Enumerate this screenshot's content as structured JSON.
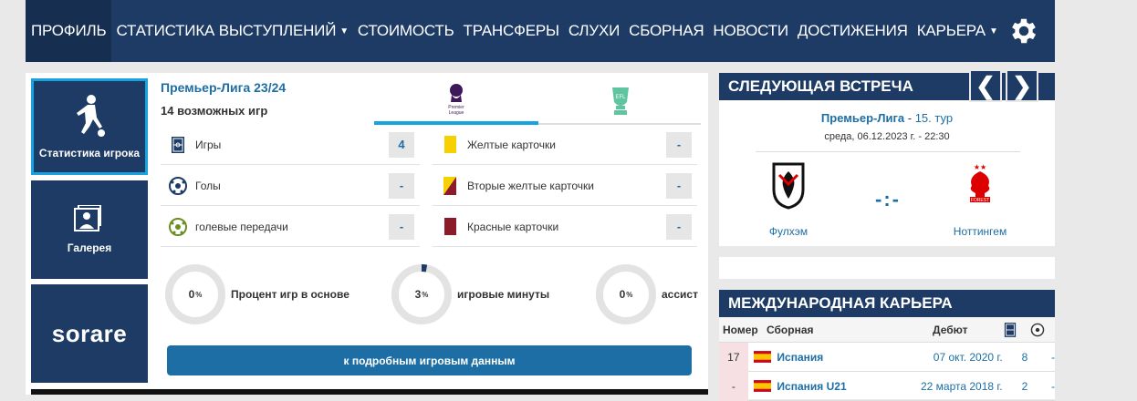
{
  "nav": {
    "items": [
      {
        "label": "ПРОФИЛЬ",
        "active": true,
        "dropdown": false
      },
      {
        "label": "СТАТИСТИКА ВЫСТУПЛЕНИЙ",
        "active": false,
        "dropdown": true
      },
      {
        "label": "СТОИМОСТЬ",
        "active": false,
        "dropdown": false
      },
      {
        "label": "ТРАНСФЕРЫ",
        "active": false,
        "dropdown": false
      },
      {
        "label": "СЛУХИ",
        "active": false,
        "dropdown": false
      },
      {
        "label": "СБОРНАЯ",
        "active": false,
        "dropdown": false
      },
      {
        "label": "НОВОСТИ",
        "active": false,
        "dropdown": false
      },
      {
        "label": "ДОСТИЖЕНИЯ",
        "active": false,
        "dropdown": false
      },
      {
        "label": "КАРЬЕРА",
        "active": false,
        "dropdown": true
      }
    ],
    "settings_icon": "gear-icon"
  },
  "tiles": {
    "player_stats": "Статистика игрока",
    "gallery": "Галерея",
    "sorare": "sorare"
  },
  "stats": {
    "league": "Премьер-Лига 23/24",
    "possible_games": "14 возможных игр",
    "competitions": [
      "Premier League",
      "EFL Cup"
    ],
    "left_rows": [
      {
        "label": "Игры",
        "value": "4",
        "icon": "pitch-icon"
      },
      {
        "label": "Голы",
        "value": "-",
        "icon": "ball-icon"
      },
      {
        "label": "голевые передачи",
        "value": "-",
        "icon": "assist-icon"
      }
    ],
    "right_rows": [
      {
        "label": "Желтые карточки",
        "value": "-",
        "icon": "yellow-card-icon"
      },
      {
        "label": "Вторые желтые карточки",
        "value": "-",
        "icon": "second-yellow-card-icon"
      },
      {
        "label": "Красные карточки",
        "value": "-",
        "icon": "red-card-icon"
      }
    ],
    "gauges": [
      {
        "value": "0",
        "unit": "%",
        "label": "Процент игр в основе",
        "fraction": 0.0
      },
      {
        "value": "3",
        "unit": "%",
        "label": "игровые минуты",
        "fraction": 0.03
      },
      {
        "value": "0",
        "unit": "%",
        "label": "ассист",
        "fraction": 0.0
      }
    ],
    "detail_button": "к подробным игровым данным"
  },
  "next_match": {
    "title": "СЛЕДУЮЩАЯ ВСТРЕЧА",
    "league": "Премьер-Лига",
    "round": "15. тур",
    "datetime": "среда, 06.12.2023 г. - 22:30",
    "home": "Фулхэм",
    "away": "Ноттингем",
    "score": "-:-",
    "prev": "❮",
    "next": "❯"
  },
  "international": {
    "title": "МЕЖДУНАРОДНАЯ КАРЬЕРА",
    "columns": {
      "number": "Номер",
      "team": "Сборная",
      "debut": "Дебют"
    },
    "rows": [
      {
        "number": "17",
        "team": "Испания",
        "debut": "07 окт. 2020 г.",
        "caps": "8",
        "goals": "-"
      },
      {
        "number": "-",
        "team": "Испания U21",
        "debut": "22 марта 2018 г.",
        "caps": "2",
        "goals": "-"
      }
    ]
  },
  "colors": {
    "navy": "#1d3b64",
    "accent_blue": "#1c6ea4",
    "highlight": "#17a2e0",
    "yellow_card": "#f7d000",
    "red_card": "#8b1a2b"
  }
}
